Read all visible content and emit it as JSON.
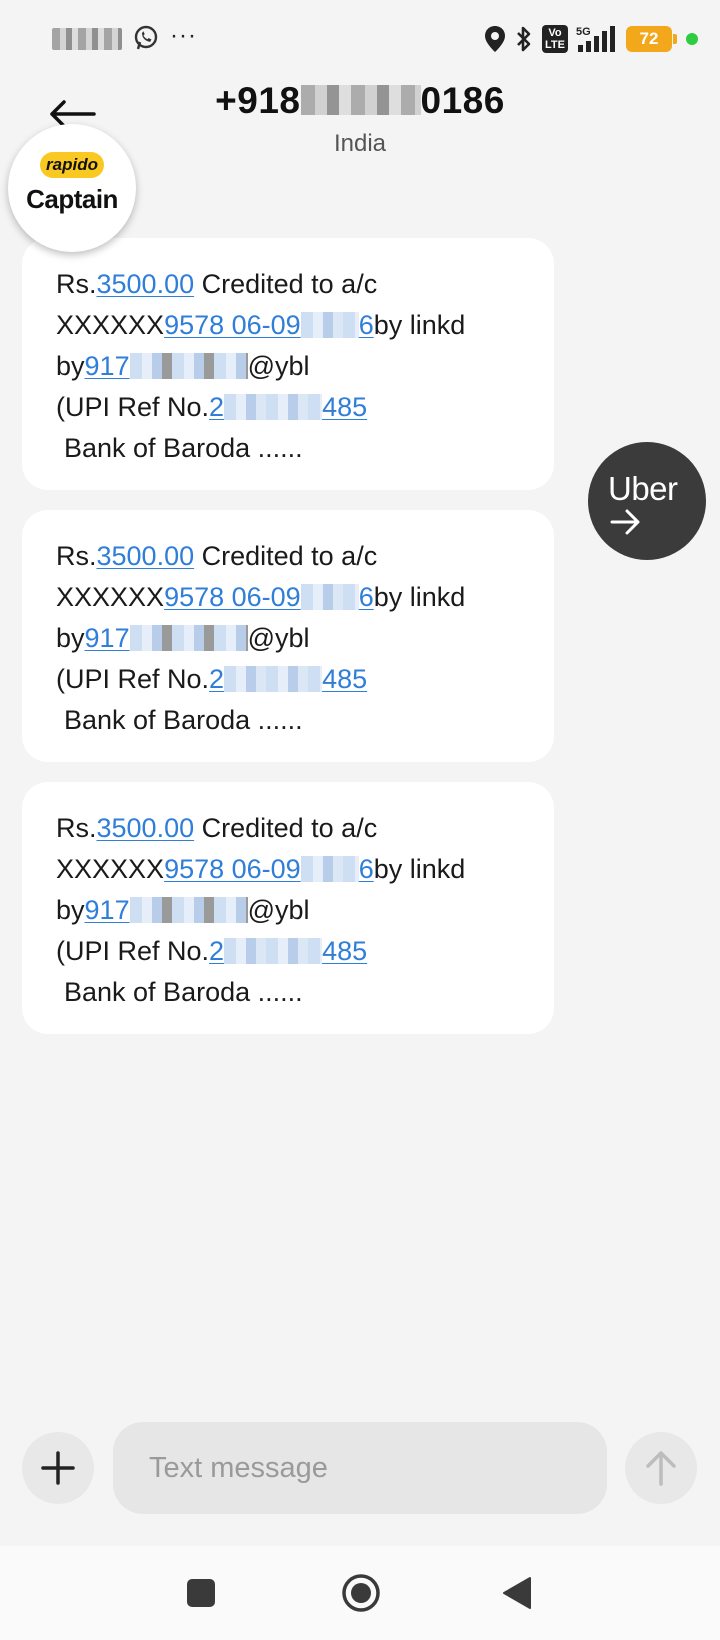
{
  "status_bar": {
    "more": "···",
    "network": "5G",
    "volte": "Vo\nLTE",
    "battery": "72",
    "colors": {
      "battery": "#f3a81c",
      "dot": "#2ecc40"
    }
  },
  "header": {
    "contact_prefix": "+918",
    "contact_suffix": "0186",
    "country": "India"
  },
  "overlays": {
    "rapido_tag": "rapido",
    "rapido_name": "Captain",
    "uber_label": "Uber"
  },
  "messages": [
    {
      "amount_prefix": "Rs.",
      "amount": "3500.00",
      "credited": " Credited to a/c",
      "acct_prefix": "XXXXXX",
      "acct_link_start": "9578 06-09",
      "acct_link_end": "6",
      "linked_by": "by linkd",
      "by": "by",
      "vpa_start": "917",
      "vpa_end": "@ybl",
      "upi_prefix": "(UPI Ref No.",
      "upi_start": "2",
      "upi_end": "485",
      "bank": "Bank of Baroda  ......"
    },
    {
      "amount_prefix": "Rs.",
      "amount": "3500.00",
      "credited": " Credited to a/c",
      "acct_prefix": "XXXXXX",
      "acct_link_start": "9578 06-09",
      "acct_link_end": "6",
      "linked_by": "by linkd",
      "by": "by",
      "vpa_start": "917",
      "vpa_end": "@ybl",
      "upi_prefix": "(UPI Ref No.",
      "upi_start": "2",
      "upi_end": "485",
      "bank": "Bank of Baroda  ......"
    },
    {
      "amount_prefix": "Rs.",
      "amount": "3500.00",
      "credited": " Credited to a/c",
      "acct_prefix": "XXXXXX",
      "acct_link_start": "9578 06-09",
      "acct_link_end": "6",
      "linked_by": "by linkd",
      "by": "by",
      "vpa_start": "917",
      "vpa_end": "@ybl",
      "upi_prefix": "(UPI Ref No.",
      "upi_start": "2",
      "upi_end": "485",
      "bank": "Bank of Baroda  ......"
    }
  ],
  "composer": {
    "placeholder": "Text message",
    "add_icon": "plus-icon",
    "send_icon": "arrow-up-icon"
  },
  "nav": {
    "recents_icon": "square-icon",
    "home_icon": "circle-icon",
    "back_icon": "triangle-back-icon"
  }
}
